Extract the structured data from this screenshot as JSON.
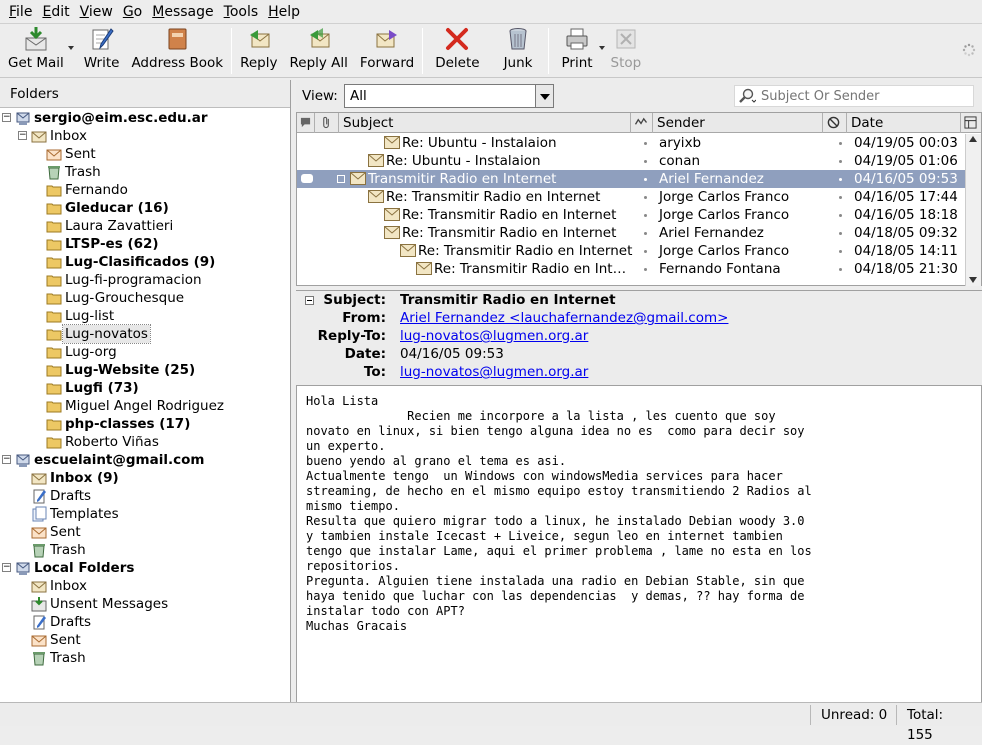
{
  "menubar": [
    "File",
    "Edit",
    "View",
    "Go",
    "Message",
    "Tools",
    "Help"
  ],
  "toolbar": {
    "get_mail": "Get Mail",
    "write": "Write",
    "address_book": "Address Book",
    "reply": "Reply",
    "reply_all": "Reply All",
    "forward": "Forward",
    "delete": "Delete",
    "junk": "Junk",
    "print": "Print",
    "stop": "Stop"
  },
  "folders": {
    "header": "Folders",
    "items": [
      {
        "label": "sergio@eim.esc.edu.ar",
        "type": "account"
      },
      {
        "label": "Inbox",
        "type": "inbox"
      },
      {
        "label": "Sent",
        "type": "sent"
      },
      {
        "label": "Trash",
        "type": "trash"
      },
      {
        "label": "Fernando",
        "type": "folder"
      },
      {
        "label": "Gleducar (16)",
        "type": "folder"
      },
      {
        "label": "Laura Zavattieri",
        "type": "folder"
      },
      {
        "label": "LTSP-es (62)",
        "type": "folder"
      },
      {
        "label": "Lug-Clasificados (9)",
        "type": "folder"
      },
      {
        "label": "Lug-fi-programacion",
        "type": "folder"
      },
      {
        "label": "Lug-Grouchesque",
        "type": "folder"
      },
      {
        "label": "Lug-list",
        "type": "folder"
      },
      {
        "label": "Lug-novatos",
        "type": "folder"
      },
      {
        "label": "Lug-org",
        "type": "folder"
      },
      {
        "label": "Lug-Website (25)",
        "type": "folder"
      },
      {
        "label": "Lugfi (73)",
        "type": "folder"
      },
      {
        "label": "Miguel Angel Rodriguez",
        "type": "folder"
      },
      {
        "label": "php-classes (17)",
        "type": "folder"
      },
      {
        "label": "Roberto Viñas",
        "type": "folder"
      },
      {
        "label": "escuelaint@gmail.com",
        "type": "account"
      },
      {
        "label": "Inbox (9)",
        "type": "inbox"
      },
      {
        "label": "Drafts",
        "type": "drafts"
      },
      {
        "label": "Templates",
        "type": "templates"
      },
      {
        "label": "Sent",
        "type": "sent"
      },
      {
        "label": "Trash",
        "type": "trash"
      },
      {
        "label": "Local Folders",
        "type": "local"
      },
      {
        "label": "Inbox",
        "type": "inbox"
      },
      {
        "label": "Unsent Messages",
        "type": "unsent"
      },
      {
        "label": "Drafts",
        "type": "drafts"
      },
      {
        "label": "Sent",
        "type": "sent"
      },
      {
        "label": "Trash",
        "type": "trash"
      }
    ]
  },
  "view": {
    "label": "View:",
    "selected": "All",
    "search_placeholder": "Subject Or Sender"
  },
  "columns": {
    "subject": "Subject",
    "sender": "Sender",
    "date": "Date"
  },
  "messages": [
    {
      "subject": "Re: Ubuntu - Instalaion",
      "sender": "aryixb",
      "date": "04/19/05 00:03"
    },
    {
      "subject": "Re: Ubuntu - Instalaion",
      "sender": "conan",
      "date": "04/19/05 01:06"
    },
    {
      "subject": "Transmitir Radio en Internet",
      "sender": "Ariel Fernandez",
      "date": "04/16/05 09:53"
    },
    {
      "subject": "Re: Transmitir Radio en Internet",
      "sender": "Jorge Carlos Franco",
      "date": "04/16/05 17:44"
    },
    {
      "subject": "Re: Transmitir Radio en Internet",
      "sender": "Jorge Carlos Franco",
      "date": "04/16/05 18:18"
    },
    {
      "subject": "Re: Transmitir Radio en Internet",
      "sender": "Ariel Fernandez",
      "date": "04/18/05 09:32"
    },
    {
      "subject": "Re: Transmitir Radio en Internet",
      "sender": "Jorge Carlos Franco",
      "date": "04/18/05 14:11"
    },
    {
      "subject": "Re: Transmitir Radio en Inter…",
      "sender": "Fernando Fontana",
      "date": "04/18/05 21:30"
    }
  ],
  "message_header": {
    "subject_label": "Subject:",
    "subject": "Transmitir Radio en Internet",
    "from_label": "From:",
    "from": "Ariel Fernandez <lauchafernandez@gmail.com>",
    "replyto_label": "Reply-To:",
    "replyto": "lug-novatos@lugmen.org.ar",
    "date_label": "Date:",
    "date": "04/16/05 09:53",
    "to_label": "To:",
    "to": "lug-novatos@lugmen.org.ar"
  },
  "message_body": "Hola Lista\n              Recien me incorpore a la lista , les cuento que soy\nnovato en linux, si bien tengo alguna idea no es  como para decir soy\nun experto.\nbueno yendo al grano el tema es asi.\nActualmente tengo  un Windows con windowsMedia services para hacer\nstreaming, de hecho en el mismo equipo estoy transmitiendo 2 Radios al\nmismo tiempo.\nResulta que quiero migrar todo a linux, he instalado Debian woody 3.0\ny tambien instale Icecast + Liveice, segun leo en internet tambien\ntengo que instalar Lame, aqui el primer problema , lame no esta en los\nrepositorios.\nPregunta. Alguien tiene instalada una radio en Debian Stable, sin que\nhaya tenido que luchar con las dependencias  y demas, ?? hay forma de\ninstalar todo con APT?\nMuchas Gracais",
  "status": {
    "unread": "Unread: 0",
    "total": "Total: 155"
  }
}
